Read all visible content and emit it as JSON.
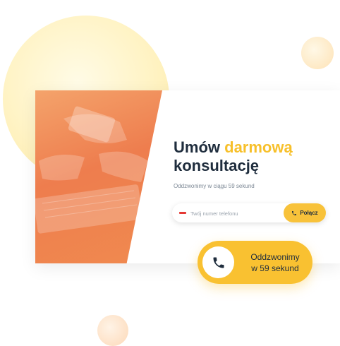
{
  "card": {
    "heading_line1": "Umów",
    "heading_accent": "darmową",
    "heading_line2": "konsultację",
    "subtitle": "Oddzwonimy w ciągu 59 sekund"
  },
  "form": {
    "phone_placeholder": "Twój numer telefonu",
    "connect_label": "Połącz"
  },
  "callback_badge": {
    "line1": "Oddzwonimy",
    "line2": "w 59 sekund"
  },
  "colors": {
    "accent": "#f7c02b",
    "heading": "#1f2d3d",
    "photo_overlay": "#ee7d4e"
  },
  "icons": [
    "phone-icon",
    "flag-icon"
  ]
}
